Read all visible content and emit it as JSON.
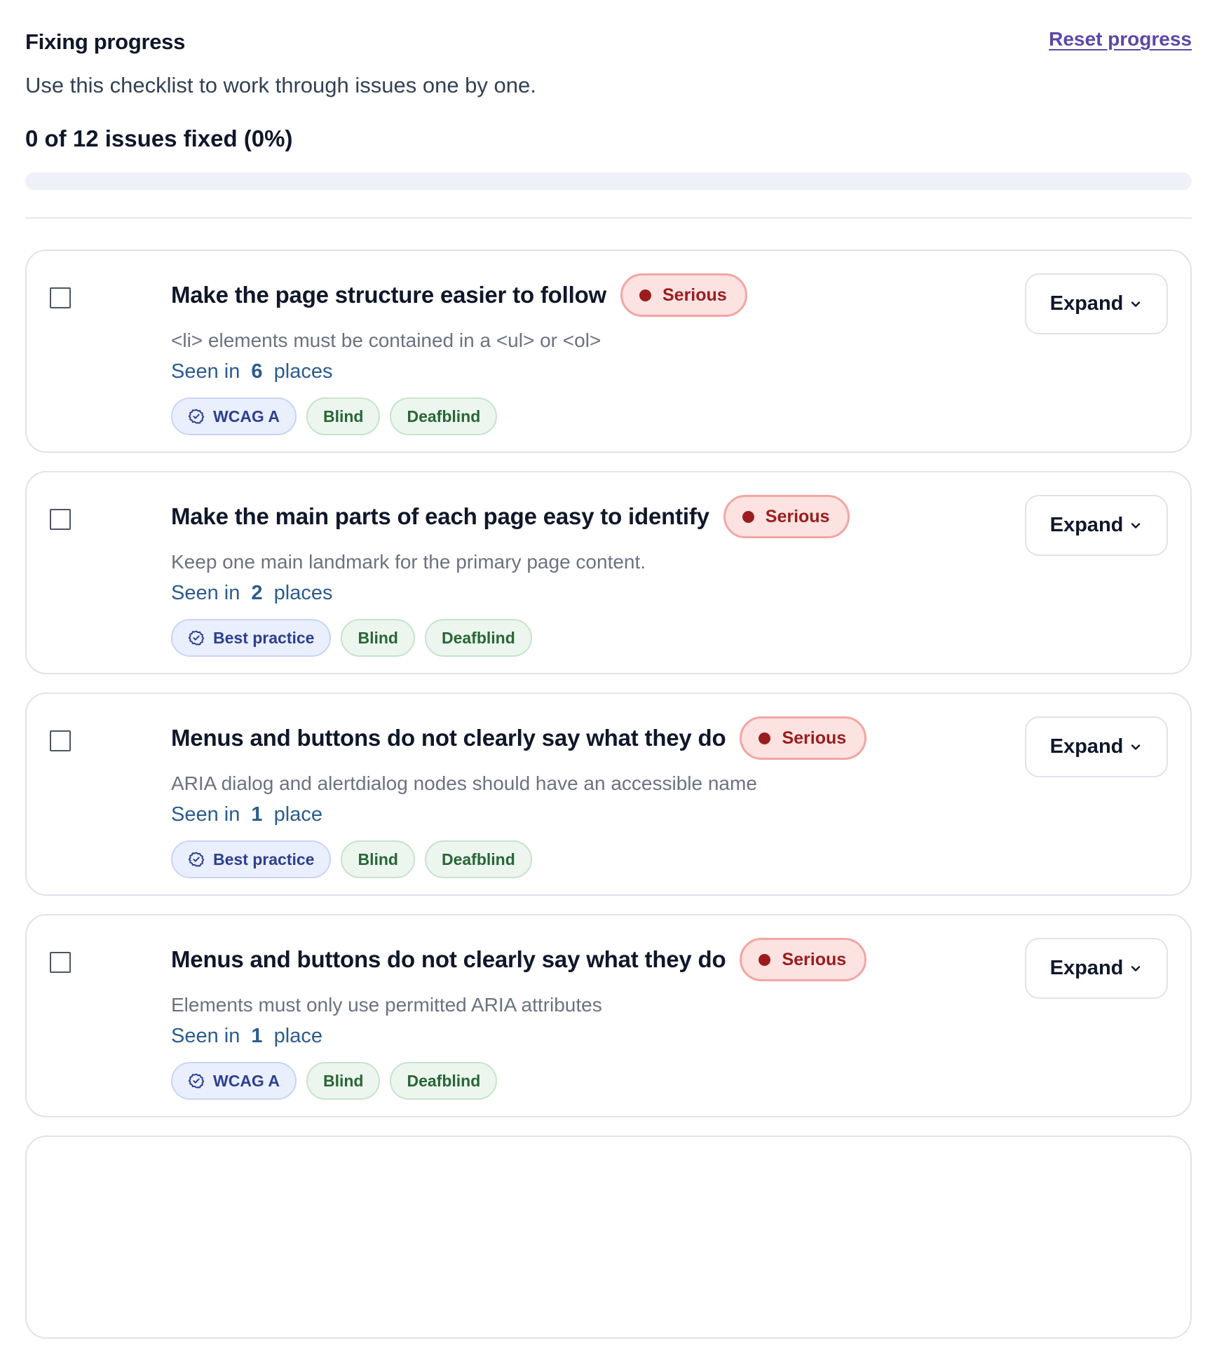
{
  "header": {
    "title": "Fixing progress",
    "reset_label": "Reset progress",
    "subtitle": "Use this checklist to work through issues one by one.",
    "progress_text": "0 of 12 issues fixed (0%)",
    "progress_fraction": 0
  },
  "colors": {
    "accent": "#5b48a8",
    "serious_bg": "#fde2e2",
    "serious_text": "#9b1c1c",
    "wcag_tag_bg": "#eaeffd",
    "disability_tag_bg": "#ecf6ee"
  },
  "issues": [
    {
      "title": "Make the page structure easier to follow",
      "severity": "Serious",
      "description": "<li> elements must be contained in a <ul> or <ol>",
      "seen_prefix": "Seen in",
      "seen_count": "6",
      "seen_suffix": "places",
      "standard_tag": "WCAG A",
      "tags": [
        "Blind",
        "Deafblind"
      ],
      "expand_label": "Expand",
      "checked": false
    },
    {
      "title": "Make the main parts of each page easy to identify",
      "severity": "Serious",
      "description": "Keep one main landmark for the primary page content.",
      "seen_prefix": "Seen in",
      "seen_count": "2",
      "seen_suffix": "places",
      "standard_tag": "Best practice",
      "tags": [
        "Blind",
        "Deafblind"
      ],
      "expand_label": "Expand",
      "checked": false
    },
    {
      "title": "Menus and buttons do not clearly say what they do",
      "severity": "Serious",
      "description": "ARIA dialog and alertdialog nodes should have an accessible name",
      "seen_prefix": "Seen in",
      "seen_count": "1",
      "seen_suffix": "place",
      "standard_tag": "Best practice",
      "tags": [
        "Blind",
        "Deafblind"
      ],
      "expand_label": "Expand",
      "checked": false
    },
    {
      "title": "Menus and buttons do not clearly say what they do",
      "severity": "Serious",
      "description": "Elements must only use permitted ARIA attributes",
      "seen_prefix": "Seen in",
      "seen_count": "1",
      "seen_suffix": "place",
      "standard_tag": "WCAG A",
      "tags": [
        "Blind",
        "Deafblind"
      ],
      "expand_label": "Expand",
      "checked": false
    }
  ]
}
